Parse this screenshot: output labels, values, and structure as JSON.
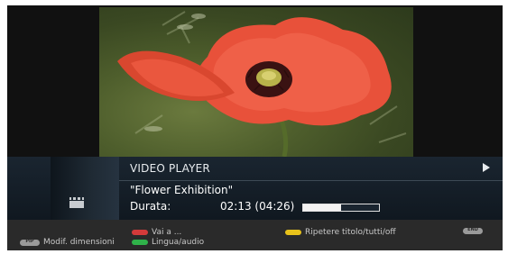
{
  "player": {
    "title": "VIDEO PLAYER",
    "clip_title": "\"Flower Exhibition\"",
    "duration_label": "Durata:",
    "duration_value": "02:13 (04:26)",
    "progress_fraction": 0.5
  },
  "footer": {
    "pip_key": "PIP",
    "pip_label": "Modif. dimensioni",
    "red_label": "Vai a ...",
    "green_label": "Lingua/audio",
    "yellow_label": "Ripetere titolo/tutti/off",
    "end_key": "END"
  },
  "icons": {
    "play": "play-icon",
    "clapperboard": "clapperboard-icon"
  },
  "colors": {
    "red": "#d33a3a",
    "green": "#2fb24a",
    "yellow": "#e8c21a",
    "info_panel": "#1a2530"
  }
}
